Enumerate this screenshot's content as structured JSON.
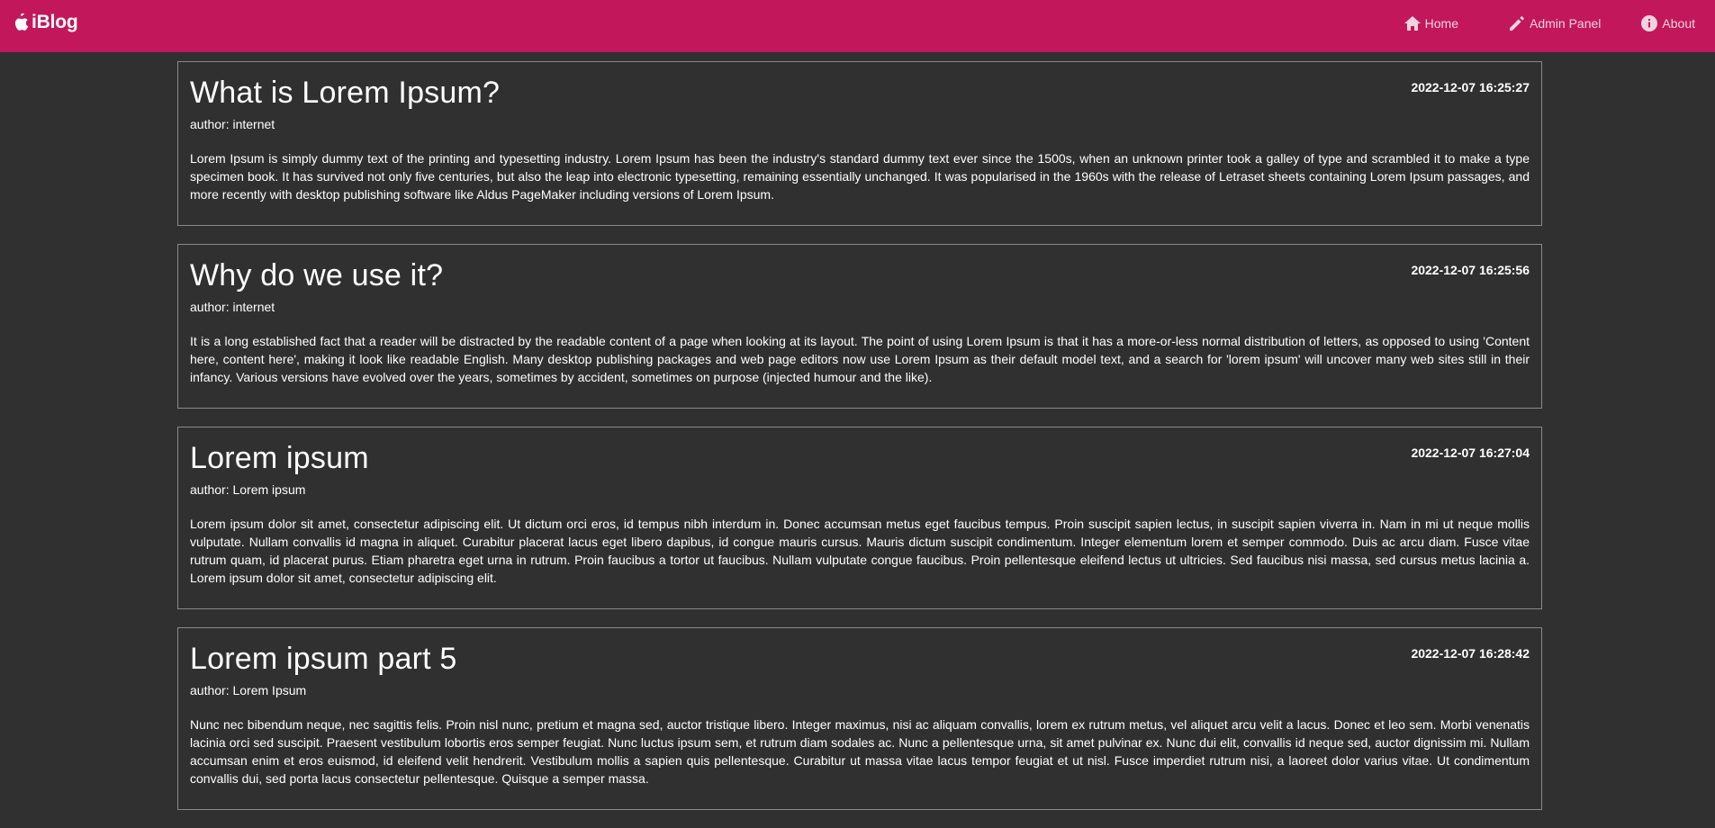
{
  "navbar": {
    "brand": "iBlog",
    "background": "#c2185b",
    "brand_icon": "apple-icon",
    "links": [
      {
        "label": "Home",
        "icon": "home-icon"
      },
      {
        "label": "Admin Panel",
        "icon": "pencil-icon"
      },
      {
        "label": "About",
        "icon": "info-icon"
      }
    ]
  },
  "posts": [
    {
      "title": "What is Lorem Ipsum?",
      "date": "2022-12-07 16:25:27",
      "author": "author: internet",
      "body": "Lorem Ipsum is simply dummy text of the printing and typesetting industry. Lorem Ipsum has been the industry's standard dummy text ever since the 1500s, when an unknown printer took a galley of type and scrambled it to make a type specimen book. It has survived not only five centuries, but also the leap into electronic typesetting, remaining essentially unchanged. It was popularised in the 1960s with the release of Letraset sheets containing Lorem Ipsum passages, and more recently with desktop publishing software like Aldus PageMaker including versions of Lorem Ipsum."
    },
    {
      "title": "Why do we use it?",
      "date": "2022-12-07 16:25:56",
      "author": "author: internet",
      "body": "It is a long established fact that a reader will be distracted by the readable content of a page when looking at its layout. The point of using Lorem Ipsum is that it has a more-or-less normal distribution of letters, as opposed to using 'Content here, content here', making it look like readable English. Many desktop publishing packages and web page editors now use Lorem Ipsum as their default model text, and a search for 'lorem ipsum' will uncover many web sites still in their infancy. Various versions have evolved over the years, sometimes by accident, sometimes on purpose (injected humour and the like)."
    },
    {
      "title": "Lorem ipsum",
      "date": "2022-12-07 16:27:04",
      "author": "author: Lorem ipsum",
      "body": "Lorem ipsum dolor sit amet, consectetur adipiscing elit. Ut dictum orci eros, id tempus nibh interdum in. Donec accumsan metus eget faucibus tempus. Proin suscipit sapien lectus, in suscipit sapien viverra in. Nam in mi ut neque mollis vulputate. Nullam convallis id magna in aliquet. Curabitur placerat lacus eget libero dapibus, id congue mauris cursus. Mauris dictum suscipit condimentum. Integer elementum lorem et semper commodo. Duis ac arcu diam. Fusce vitae rutrum quam, id placerat purus. Etiam pharetra eget urna in rutrum. Proin faucibus a tortor ut faucibus. Nullam vulputate congue faucibus. Proin pellentesque eleifend lectus ut ultricies. Sed faucibus nisi massa, sed cursus metus lacinia a. Lorem ipsum dolor sit amet, consectetur adipiscing elit."
    },
    {
      "title": "Lorem ipsum part 5",
      "date": "2022-12-07 16:28:42",
      "author": "author: Lorem Ipsum",
      "body": "Nunc nec bibendum neque, nec sagittis felis. Proin nisl nunc, pretium et magna sed, auctor tristique libero. Integer maximus, nisi ac aliquam convallis, lorem ex rutrum metus, vel aliquet arcu velit a lacus. Donec et leo sem. Morbi venenatis lacinia orci sed suscipit. Praesent vestibulum lobortis eros semper feugiat. Nunc luctus ipsum sem, et rutrum diam sodales ac. Nunc a pellentesque urna, sit amet pulvinar ex. Nunc dui elit, convallis id neque sed, auctor dignissim mi. Nullam accumsan enim et eros euismod, id eleifend velit hendrerit. Vestibulum mollis a sapien quis pellentesque. Curabitur ut massa vitae lacus tempor feugiat et ut nisl. Fusce imperdiet rutrum nisi, a laoreet dolor varius vitae. Ut condimentum convallis dui, sed porta lacus consectetur pellentesque. Quisque a semper massa."
    }
  ]
}
